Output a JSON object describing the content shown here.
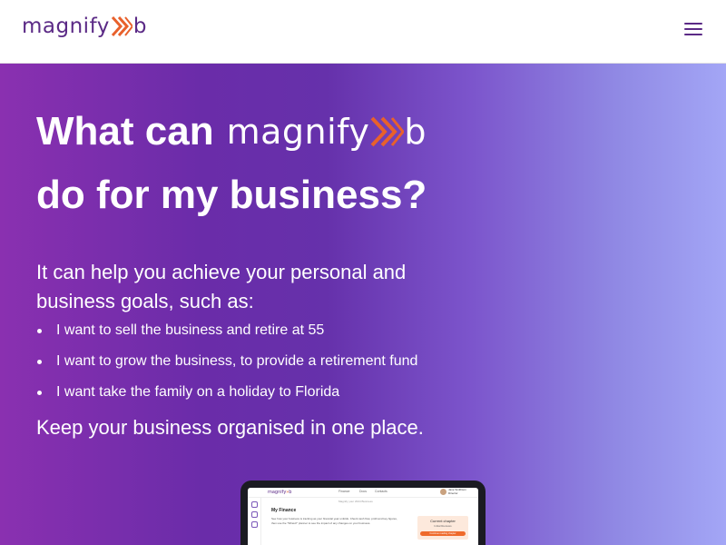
{
  "header": {
    "logo": {
      "text_before": "magnify",
      "text_after": "b"
    },
    "menu_icon": "hamburger-menu-icon"
  },
  "hero": {
    "title_prefix": "What can",
    "title_logo": {
      "text_before": "magnify",
      "text_after": "b"
    },
    "title_line2": "do for my business?",
    "intro": "It can help you achieve your personal and business goals, such as:",
    "goals": [
      "I want to sell the business and retire at 55",
      "I want to grow the business, to provide a retirement fund",
      "I want take the family on a holiday to Florida"
    ],
    "tagline": "Keep your business organised in one place."
  },
  "device_preview": {
    "logo": {
      "text_before": "magnify",
      "text_after": "b"
    },
    "nav_links": [
      "Finance",
      "Docs",
      "Contacts"
    ],
    "user_name": "Jane Smithson",
    "user_role": "Director",
    "subtitle": "Magnify your 2024 Business",
    "title": "My Finance",
    "body": "See how your business is tracking as your financial year unfolds. Check cash flow, profit and key figures, then use the \"What-If\" planner to see the impact of any changes on your business.",
    "card_title": "Current chapter",
    "card_sub": "Initial Reviews",
    "card_button": "Continue reading chapter"
  },
  "colors": {
    "brand_purple": "#5b2a86",
    "brand_orange": "#e8612c",
    "hero_gradient_start": "#8a30b0",
    "hero_gradient_end": "#a3a6f6"
  }
}
